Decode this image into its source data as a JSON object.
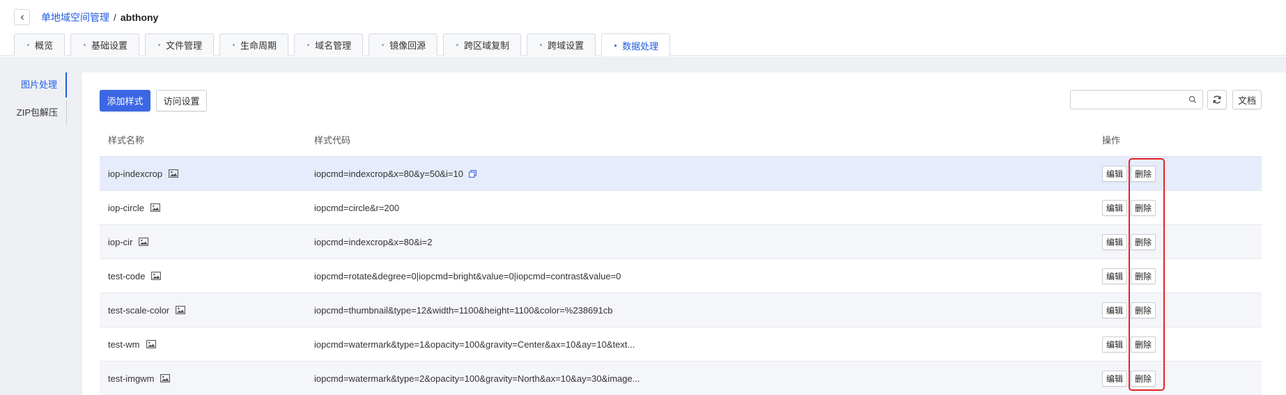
{
  "breadcrumb": {
    "parent": "单地域空间管理",
    "separator": "/",
    "current": "abthony"
  },
  "tabs": [
    {
      "label": "概览",
      "active": false
    },
    {
      "label": "基础设置",
      "active": false
    },
    {
      "label": "文件管理",
      "active": false
    },
    {
      "label": "生命周期",
      "active": false
    },
    {
      "label": "域名管理",
      "active": false
    },
    {
      "label": "镜像回源",
      "active": false
    },
    {
      "label": "跨区域复制",
      "active": false
    },
    {
      "label": "跨域设置",
      "active": false
    },
    {
      "label": "数据处理",
      "active": true
    }
  ],
  "sidebar": {
    "items": [
      {
        "label": "图片处理",
        "active": true
      },
      {
        "label": "ZIP包解压",
        "active": false
      }
    ]
  },
  "toolbar": {
    "add_label": "添加样式",
    "access_label": "访问设置",
    "search_value": "",
    "search_placeholder": "",
    "doc_label": "文档"
  },
  "table": {
    "headers": {
      "name": "样式名称",
      "code": "样式代码",
      "op": "操作"
    },
    "edit_label": "编辑",
    "delete_label": "删除",
    "rows": [
      {
        "name": "iop-indexcrop",
        "code": "iopcmd=indexcrop&x=80&y=50&i=10"
      },
      {
        "name": "iop-circle",
        "code": "iopcmd=circle&r=200"
      },
      {
        "name": "iop-cir",
        "code": "iopcmd=indexcrop&x=80&i=2"
      },
      {
        "name": "test-code",
        "code": "iopcmd=rotate&degree=0|iopcmd=bright&value=0|iopcmd=contrast&value=0"
      },
      {
        "name": "test-scale-color",
        "code": "iopcmd=thumbnail&type=12&width=1100&height=1100&color=%238691cb"
      },
      {
        "name": "test-wm",
        "code": "iopcmd=watermark&type=1&opacity=100&gravity=Center&ax=10&ay=10&text..."
      },
      {
        "name": "test-imgwm",
        "code": "iopcmd=watermark&type=2&opacity=100&gravity=North&ax=10&ay=30&image..."
      }
    ]
  },
  "icons": {
    "back": "chevron-left-icon",
    "image": "image-icon",
    "copy": "copy-icon",
    "search": "search-icon",
    "refresh": "refresh-icon"
  },
  "colors": {
    "accent": "#3c67e4",
    "link": "#1f5ce0",
    "highlight_row": "#e6ecfb",
    "annotation": "#e52222"
  }
}
